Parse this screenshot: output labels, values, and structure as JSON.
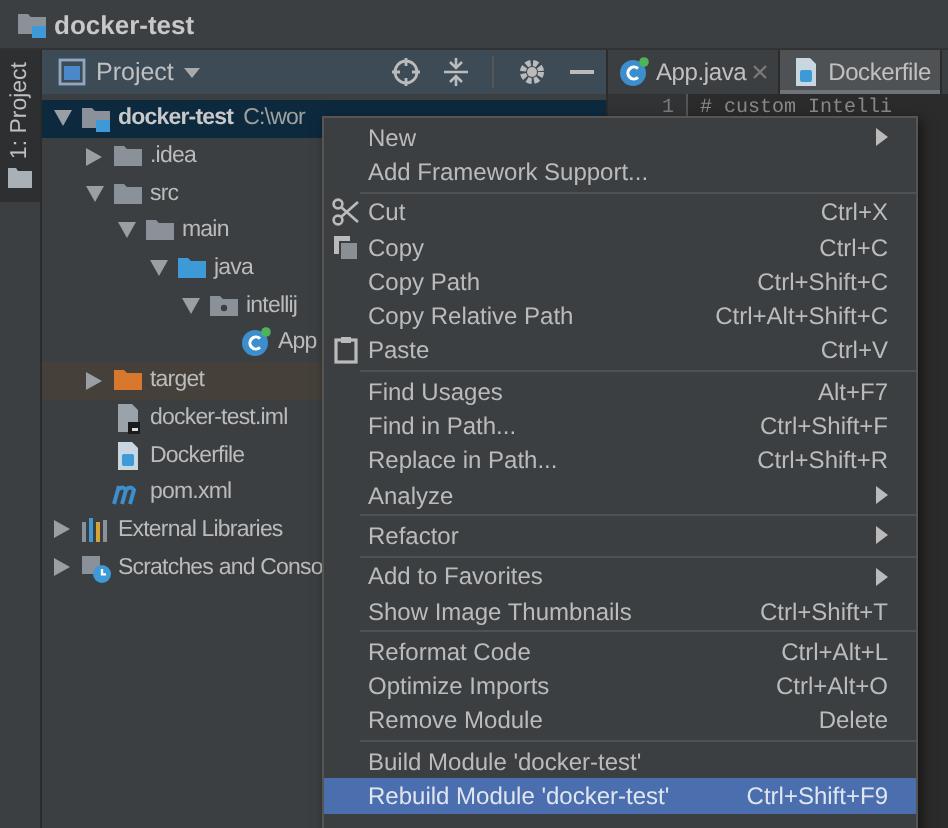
{
  "window": {
    "title": "docker-test"
  },
  "tool_strip": {
    "tab": "1: Project",
    "selected": true
  },
  "project_panel": {
    "title": "Project",
    "tree": [
      {
        "label": "docker-test",
        "path": "C:\\wor",
        "kind": "module",
        "expanded": true,
        "selected": true,
        "children": [
          {
            "label": ".idea",
            "kind": "folder",
            "expanded": false,
            "selected": false
          },
          {
            "label": "src",
            "kind": "folder",
            "expanded": true,
            "selected": false,
            "children": [
              {
                "label": "main",
                "kind": "folder",
                "expanded": true,
                "selected": false,
                "children": [
                  {
                    "label": "java",
                    "kind": "source",
                    "expanded": true,
                    "selected": false,
                    "children": [
                      {
                        "label": "intellij",
                        "kind": "package",
                        "expanded": true,
                        "selected": false,
                        "children": [
                          {
                            "label": "App",
                            "kind": "class",
                            "selected": false
                          }
                        ]
                      }
                    ]
                  }
                ]
              }
            ]
          },
          {
            "label": "target",
            "kind": "excluded",
            "expanded": false,
            "selected": false
          },
          {
            "label": "docker-test.iml",
            "kind": "iml",
            "selected": false
          },
          {
            "label": "Dockerfile",
            "kind": "docker",
            "selected": false
          },
          {
            "label": "pom.xml",
            "kind": "maven",
            "selected": false
          }
        ]
      },
      {
        "label": "External Libraries",
        "kind": "libraries",
        "expanded": false,
        "selected": false
      },
      {
        "label": "Scratches and Conso",
        "kind": "scratches",
        "expanded": false,
        "selected": false
      }
    ]
  },
  "editor": {
    "tabs": [
      {
        "label": "App.java",
        "kind": "class",
        "closable": true,
        "selected": false
      },
      {
        "label": "Dockerfile",
        "kind": "docker",
        "closable": false,
        "selected": true
      }
    ],
    "line_number": "1",
    "line": "# custom Intelli"
  },
  "context_menu": {
    "groups": [
      [
        {
          "label": "New",
          "submenu": true,
          "kind": "plain",
          "selected": false
        },
        {
          "label": "Add Framework Support...",
          "kind": "plain",
          "selected": false
        }
      ],
      [
        {
          "label": "Cut",
          "shortcut": "Ctrl+X",
          "kind": "cut",
          "selected": false
        },
        {
          "label": "Copy",
          "shortcut": "Ctrl+C",
          "kind": "copy",
          "selected": false
        },
        {
          "label": "Copy Path",
          "shortcut": "Ctrl+Shift+C",
          "kind": "plain",
          "selected": false
        },
        {
          "label": "Copy Relative Path",
          "shortcut": "Ctrl+Alt+Shift+C",
          "kind": "plain",
          "selected": false
        },
        {
          "label": "Paste",
          "shortcut": "Ctrl+V",
          "kind": "paste",
          "selected": false
        }
      ],
      [
        {
          "label": "Find Usages",
          "shortcut": "Alt+F7",
          "kind": "plain",
          "selected": false
        },
        {
          "label": "Find in Path...",
          "shortcut": "Ctrl+Shift+F",
          "kind": "plain",
          "selected": false
        },
        {
          "label": "Replace in Path...",
          "shortcut": "Ctrl+Shift+R",
          "kind": "plain",
          "selected": false
        },
        {
          "label": "Analyze",
          "submenu": true,
          "kind": "plain",
          "selected": false
        }
      ],
      [
        {
          "label": "Refactor",
          "submenu": true,
          "kind": "plain",
          "selected": false
        }
      ],
      [
        {
          "label": "Add to Favorites",
          "submenu": true,
          "kind": "plain",
          "selected": false
        },
        {
          "label": "Show Image Thumbnails",
          "shortcut": "Ctrl+Shift+T",
          "kind": "plain",
          "selected": false
        }
      ],
      [
        {
          "label": "Reformat Code",
          "shortcut": "Ctrl+Alt+L",
          "kind": "plain",
          "selected": false
        },
        {
          "label": "Optimize Imports",
          "shortcut": "Ctrl+Alt+O",
          "kind": "plain",
          "selected": false
        },
        {
          "label": "Remove Module",
          "shortcut": "Delete",
          "kind": "plain",
          "selected": false
        }
      ],
      [
        {
          "label": "Build Module 'docker-test'",
          "kind": "plain",
          "selected": false
        },
        {
          "label": "Rebuild Module 'docker-test'",
          "shortcut": "Ctrl+Shift+F9",
          "kind": "plain",
          "selected": true
        }
      ]
    ]
  }
}
